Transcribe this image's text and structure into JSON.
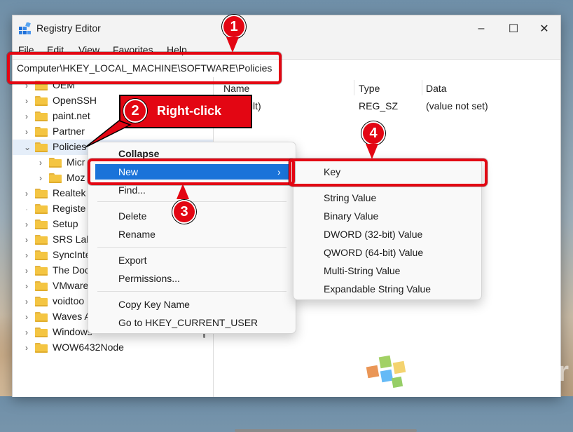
{
  "window": {
    "title": "Registry Editor"
  },
  "controls": {
    "minimize": "–",
    "maximize": "☐",
    "close": "✕"
  },
  "menu": [
    "File",
    "Edit",
    "View",
    "Favorites",
    "Help"
  ],
  "address": {
    "path": "Computer\\HKEY_LOCAL_MACHINE\\SOFTWARE\\Policies"
  },
  "tree": [
    {
      "label": "OEM"
    },
    {
      "label": "OpenSSH"
    },
    {
      "label": "paint.net"
    },
    {
      "label": "Partner"
    },
    {
      "label": "Policies"
    },
    {
      "label": "Micr"
    },
    {
      "label": "Moz"
    },
    {
      "label": "Realtek"
    },
    {
      "label": "Registe"
    },
    {
      "label": "Setup"
    },
    {
      "label": "SRS Lab"
    },
    {
      "label": "SyncInte"
    },
    {
      "label": "The Doc"
    },
    {
      "label": "VMware"
    },
    {
      "label": "voidtoo"
    },
    {
      "label": "Waves A"
    },
    {
      "label": "Windows"
    },
    {
      "label": "WOW6432Node"
    }
  ],
  "values_pane": {
    "headers": {
      "name": "Name",
      "type": "Type",
      "data": "Data"
    },
    "row": {
      "name": "(Default)",
      "type": "REG_SZ",
      "data": "(value not set)"
    }
  },
  "context_menu": {
    "collapse": "Collapse",
    "new": "New",
    "find": "Find...",
    "delete": "Delete",
    "rename": "Rename",
    "export": "Export",
    "permissions": "Permissions...",
    "copy_key_name": "Copy Key Name",
    "goto": "Go to HKEY_CURRENT_USER",
    "submenu_arrow": "›"
  },
  "submenu": {
    "key": "Key",
    "items": [
      "String Value",
      "Binary Value",
      "DWORD (32-bit) Value",
      "QWORD (64-bit) Value",
      "Multi-String Value",
      "Expandable String Value"
    ]
  },
  "annotations": {
    "step1": "1",
    "step2": "2",
    "step3": "3",
    "step4": "4",
    "callout": "Right-click",
    "accent": "#e30613"
  },
  "watermark": {
    "text": "WinBuzzer"
  }
}
